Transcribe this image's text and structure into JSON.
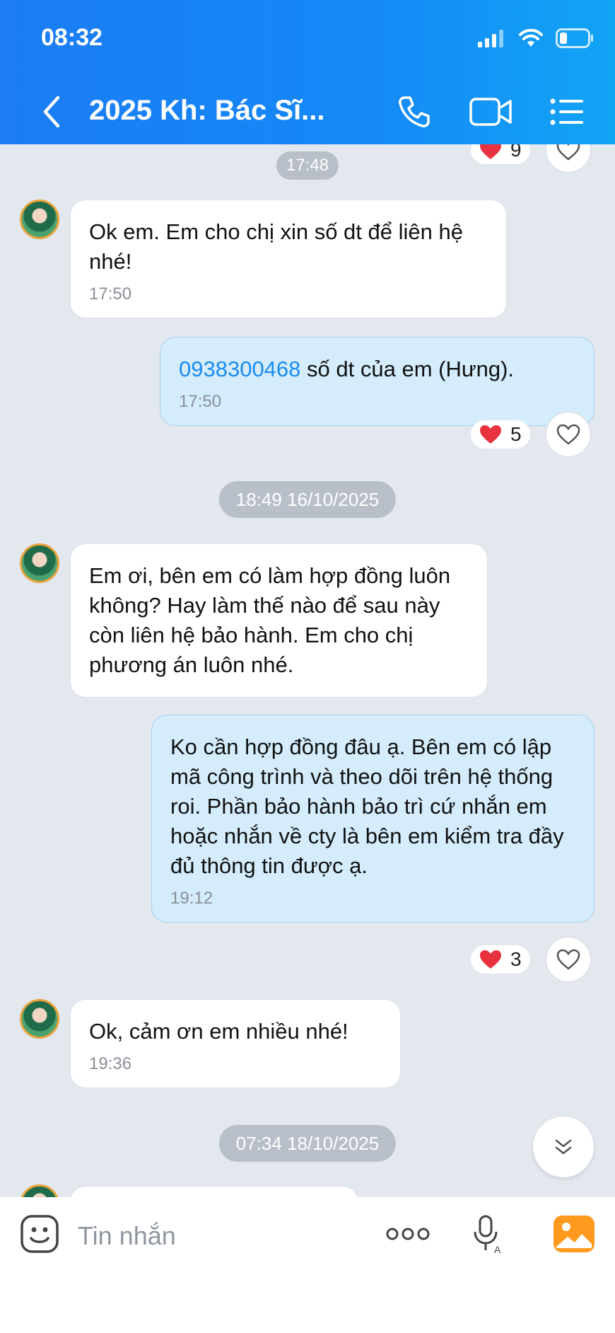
{
  "status_bar": {
    "time": "08:32"
  },
  "header": {
    "title": "2025 Kh: Bác Sĩ..."
  },
  "messages": [
    {
      "text": "Ok em. Em cho chị xin số dt để liên hệ nhé!",
      "time": "17:50"
    },
    {
      "phone": "0938300468",
      "text": " số dt của em (Hưng).",
      "time": "17:50"
    },
    {
      "text": "Em ơi, bên em có làm hợp đồng luôn không? Hay làm thế nào để sau này còn liên hệ bảo hành. Em cho chị phương án luôn nhé.",
      "time": ""
    },
    {
      "text": "Ko cần hợp đồng đâu ạ. Bên em có lập mã công trình và theo dõi trên hệ thống roi. Phần bảo hành bảo trì cứ nhắn em hoặc nhắn về cty là bên em kiểm tra đầy đủ thông tin được ạ.",
      "time": "19:12"
    },
    {
      "text": "Ok, cảm ơn em nhiều nhé!",
      "time": "19:36"
    }
  ],
  "dividers": [
    "17:48",
    "18:49 16/10/2025",
    "07:34 18/10/2025"
  ],
  "reactions": [
    "9",
    "5",
    "3"
  ],
  "input": {
    "placeholder": "Tin nhắn"
  },
  "colors": {
    "header": "#1b7cf4",
    "outgoing_bubble": "#d4ecfc",
    "link": "#1a8cf0",
    "heart": "#e8323f"
  }
}
